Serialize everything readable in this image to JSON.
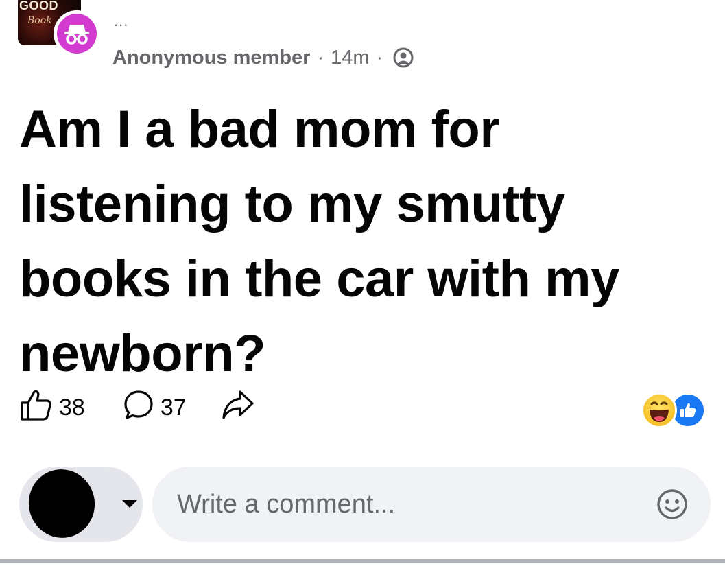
{
  "group": {
    "logo_text": "GOOD",
    "logo_script": "Book",
    "icon": "group-logo-icon"
  },
  "header": {
    "more_label": "...",
    "author": "Anonymous member",
    "separator": "·",
    "time": "14m",
    "privacy_icon": "group-privacy-icon",
    "anon_icon": "incognito-icon"
  },
  "post": {
    "text": "Am I a bad mom for listening to my smutty books in the car with my newborn?"
  },
  "actions": {
    "like_count": "38",
    "comment_count": "37",
    "like_icon": "thumbs-up-outline-icon",
    "comment_icon": "comment-bubble-icon",
    "share_icon": "share-arrow-icon"
  },
  "reactions": {
    "icons": [
      "haha-reaction-icon",
      "like-reaction-icon"
    ],
    "like_color": "#1877f2",
    "haha_color": "#f7c229"
  },
  "composer": {
    "placeholder": "Write a comment...",
    "emoji_icon": "smiley-icon",
    "caret_icon": "caret-down-icon"
  },
  "colors": {
    "anon_badge": "#d33ad0",
    "meta_text": "#65676b",
    "input_bg": "#f0f2f5"
  }
}
